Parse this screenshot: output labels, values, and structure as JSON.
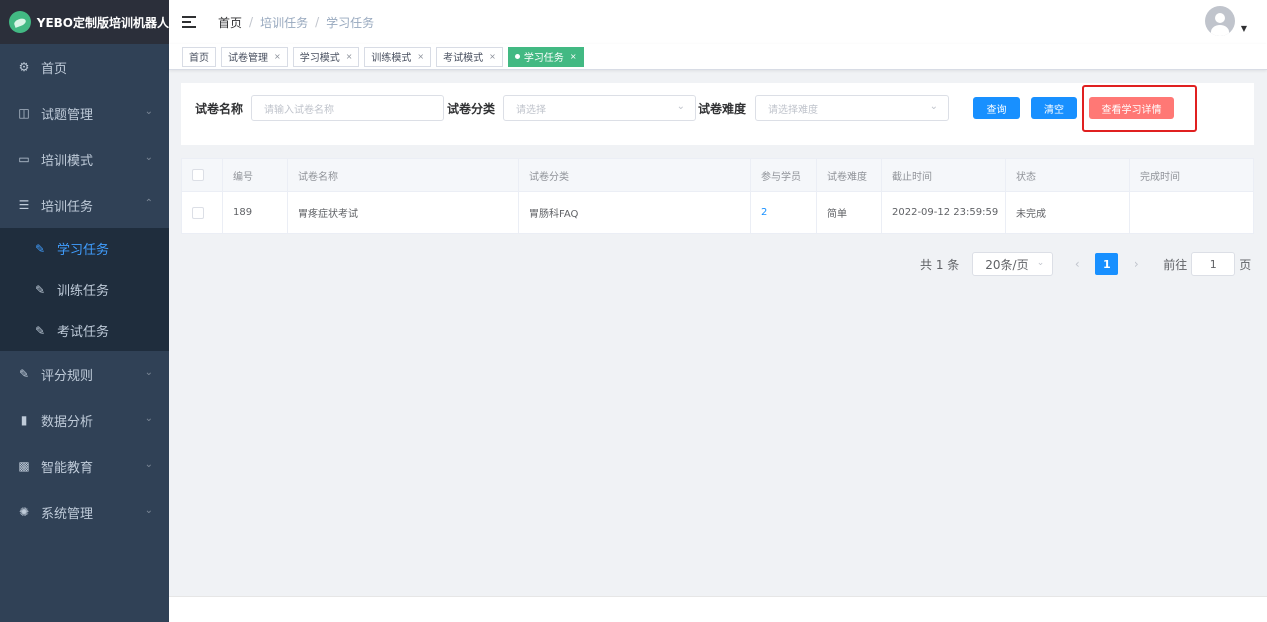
{
  "app": {
    "title": "YEBO定制版培训机器人"
  },
  "sidebar": {
    "items": [
      {
        "label": "首页",
        "icon": "dashboard-icon",
        "has_children": false
      },
      {
        "label": "试题管理",
        "icon": "book-icon",
        "has_children": true
      },
      {
        "label": "培训模式",
        "icon": "monitor-icon",
        "has_children": true
      },
      {
        "label": "培训任务",
        "icon": "list-icon",
        "has_children": true,
        "expanded": true
      }
    ],
    "subitems": [
      {
        "label": "学习任务",
        "active": true
      },
      {
        "label": "训练任务",
        "active": false
      },
      {
        "label": "考试任务",
        "active": false
      }
    ],
    "items_after": [
      {
        "label": "评分规则",
        "icon": "edit-icon",
        "has_children": true
      },
      {
        "label": "数据分析",
        "icon": "chart-icon",
        "has_children": true
      },
      {
        "label": "智能教育",
        "icon": "education-icon",
        "has_children": true
      },
      {
        "label": "系统管理",
        "icon": "settings-icon",
        "has_children": true
      }
    ]
  },
  "header": {
    "breadcrumb": [
      "首页",
      "培训任务",
      "学习任务"
    ]
  },
  "tags": [
    {
      "label": "首页",
      "closable": false,
      "active": false
    },
    {
      "label": "试卷管理",
      "closable": true,
      "active": false
    },
    {
      "label": "学习模式",
      "closable": true,
      "active": false
    },
    {
      "label": "训练模式",
      "closable": true,
      "active": false
    },
    {
      "label": "考试模式",
      "closable": true,
      "active": false
    },
    {
      "label": "学习任务",
      "closable": true,
      "active": true
    }
  ],
  "filters": {
    "name_label": "试卷名称",
    "name_placeholder": "请输入试卷名称",
    "category_label": "试卷分类",
    "category_placeholder": "请选择",
    "difficulty_label": "试卷难度",
    "difficulty_placeholder": "请选择难度",
    "query_button": "查询",
    "clear_button": "清空",
    "details_button": "查看学习详情"
  },
  "table": {
    "columns": [
      "编号",
      "试卷名称",
      "试卷分类",
      "参与学员",
      "试卷难度",
      "截止时间",
      "状态",
      "完成时间"
    ],
    "rows": [
      {
        "id": "189",
        "name": "胃疼症状考试",
        "category": "胃肠科FAQ",
        "participants": "2",
        "difficulty": "简单",
        "deadline": "2022-09-12 23:59:59",
        "status": "未完成",
        "completed": ""
      }
    ]
  },
  "pagination": {
    "total": "共 1 条",
    "page_size": "20条/页",
    "current_page": "1",
    "goto_label": "前往",
    "goto_value": "1",
    "page_unit": "页"
  },
  "colors": {
    "sidebar_bg": "#304156",
    "active_tag": "#42b983",
    "primary": "#1890ff",
    "danger": "#ff7875",
    "highlight": "#e02020"
  }
}
